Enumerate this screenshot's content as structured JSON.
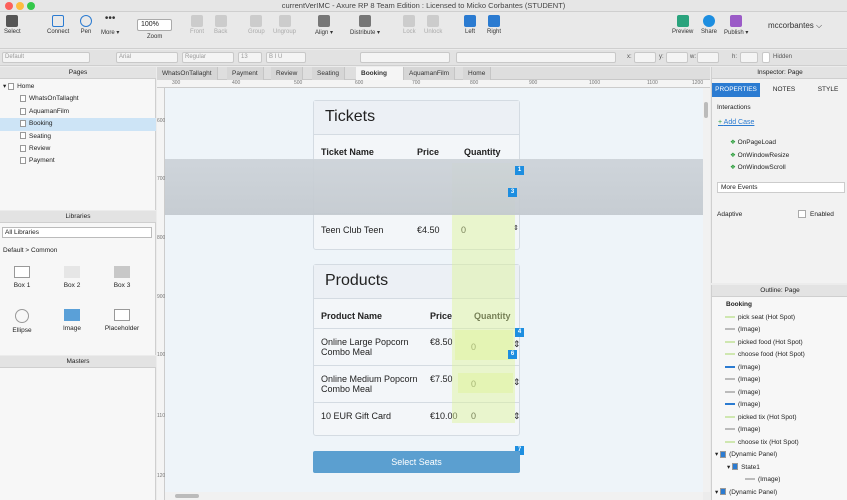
{
  "window": {
    "title": "currentVerIMC - Axure RP 8 Team Edition : Licensed to Micko Corbantes (STUDENT)"
  },
  "toolbar": {
    "select": "Select",
    "connect": "Connect",
    "pen": "Pen",
    "more": "More ▾",
    "zoom_value": "100%",
    "zoom_label": "Zoom",
    "front": "Front",
    "back": "Back",
    "group": "Group",
    "ungroup": "Ungroup",
    "align": "Align ▾",
    "distribute": "Distribute ▾",
    "lock": "Lock",
    "unlock": "Unlock",
    "left": "Left",
    "right": "Right",
    "preview": "Preview",
    "share": "Share",
    "publish": "Publish ▾",
    "user": "mccorbantes ⌵"
  },
  "format": {
    "style": "Default",
    "font": "Arial",
    "weight": "Regular",
    "size": "13",
    "x_label": "x:",
    "y_label": "y:",
    "w_label": "w:",
    "h_label": "h:",
    "hidden": "Hidden"
  },
  "pages": {
    "title": "Pages",
    "items": [
      {
        "label": "Home",
        "level": 0
      },
      {
        "label": "WhatsOnTallaght",
        "level": 1
      },
      {
        "label": "AquamanFilm",
        "level": 1
      },
      {
        "label": "Booking",
        "level": 1
      },
      {
        "label": "Seating",
        "level": 1
      },
      {
        "label": "Review",
        "level": 1
      },
      {
        "label": "Payment",
        "level": 1
      }
    ]
  },
  "libraries": {
    "title": "Libraries",
    "selected": "All Libraries",
    "group": "Default > Common",
    "items": [
      "Box 1",
      "Box 2",
      "Box 3",
      "Ellipse",
      "Image",
      "Placeholder"
    ]
  },
  "masters": {
    "title": "Masters"
  },
  "tabs": [
    "WhatsOnTallaght",
    "Payment",
    "Review",
    "Seating",
    "Booking",
    "AquamanFilm",
    "Home"
  ],
  "active_tab": "Booking",
  "ruler": {
    "h": [
      "300",
      "400",
      "500",
      "600",
      "700",
      "800",
      "900",
      "1000",
      "1100",
      "1200"
    ],
    "v": [
      "600",
      "700",
      "800",
      "900",
      "1000",
      "1100",
      "1200"
    ]
  },
  "tickets": {
    "title": "Tickets",
    "headers": [
      "Ticket Name",
      "Price",
      "Quantity"
    ],
    "rows": [
      {
        "name": "Teen Club Teen",
        "price": "€4.50",
        "qty": "0"
      }
    ]
  },
  "products": {
    "title": "Products",
    "headers": [
      "Product Name",
      "Price",
      "Quantity"
    ],
    "rows": [
      {
        "name": "Online Large Popcorn Combo Meal",
        "price": "€8.50",
        "qty": "0"
      },
      {
        "name": "Online Medium Popcorn Combo Meal",
        "price": "€7.50",
        "qty": "0"
      },
      {
        "name": "10 EUR Gift Card",
        "price": "€10.00",
        "qty": "0"
      }
    ]
  },
  "markers": [
    "1",
    "3",
    "4",
    "6",
    "7"
  ],
  "select_seats": "Select Seats",
  "inspector": {
    "title": "Inspector: Page",
    "tabs": [
      "PROPERTIES",
      "NOTES",
      "STYLE"
    ],
    "interactions": "Interactions",
    "add_case": "Add Case",
    "events": [
      "OnPageLoad",
      "OnWindowResize",
      "OnWindowScroll"
    ],
    "more_events": "More Events",
    "adaptive": "Adaptive",
    "enabled": "Enabled"
  },
  "outline": {
    "title": "Outline: Page",
    "root": "Booking",
    "items": [
      "pick seat (Hot Spot)",
      "(Image)",
      "picked food (Hot Spot)",
      "choose food (Hot Spot)",
      "(Image)",
      "(Image)",
      "(Image)",
      "(Image)",
      "picked tix (Hot Spot)",
      "(Image)",
      "choose tix (Hot Spot)",
      "(Dynamic Panel)",
      "State1",
      "(Image)",
      "(Dynamic Panel)"
    ]
  },
  "colors": {
    "accent": "#1d8ee0",
    "button": "#5b9fd0",
    "highlight": "#def596"
  }
}
